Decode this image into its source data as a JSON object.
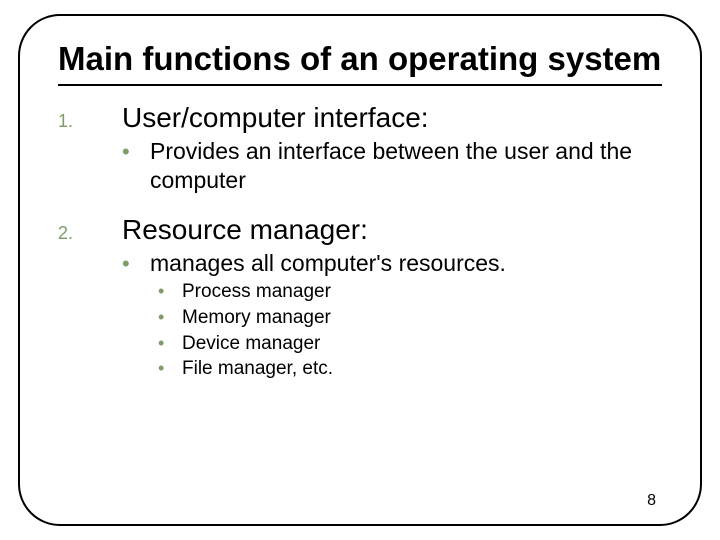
{
  "title": "Main functions of an operating system",
  "items": [
    {
      "num": "1.",
      "heading": "User/computer interface:",
      "bullets": [
        {
          "text": "Provides an interface between the user and the computer",
          "subs": []
        }
      ]
    },
    {
      "num": "2.",
      "heading": "Resource manager:",
      "bullets": [
        {
          "text": "manages all computer's resources.",
          "subs": [
            "Process manager",
            "Memory manager",
            "Device manager",
            "File manager,  etc."
          ]
        }
      ]
    }
  ],
  "page_number": "8"
}
